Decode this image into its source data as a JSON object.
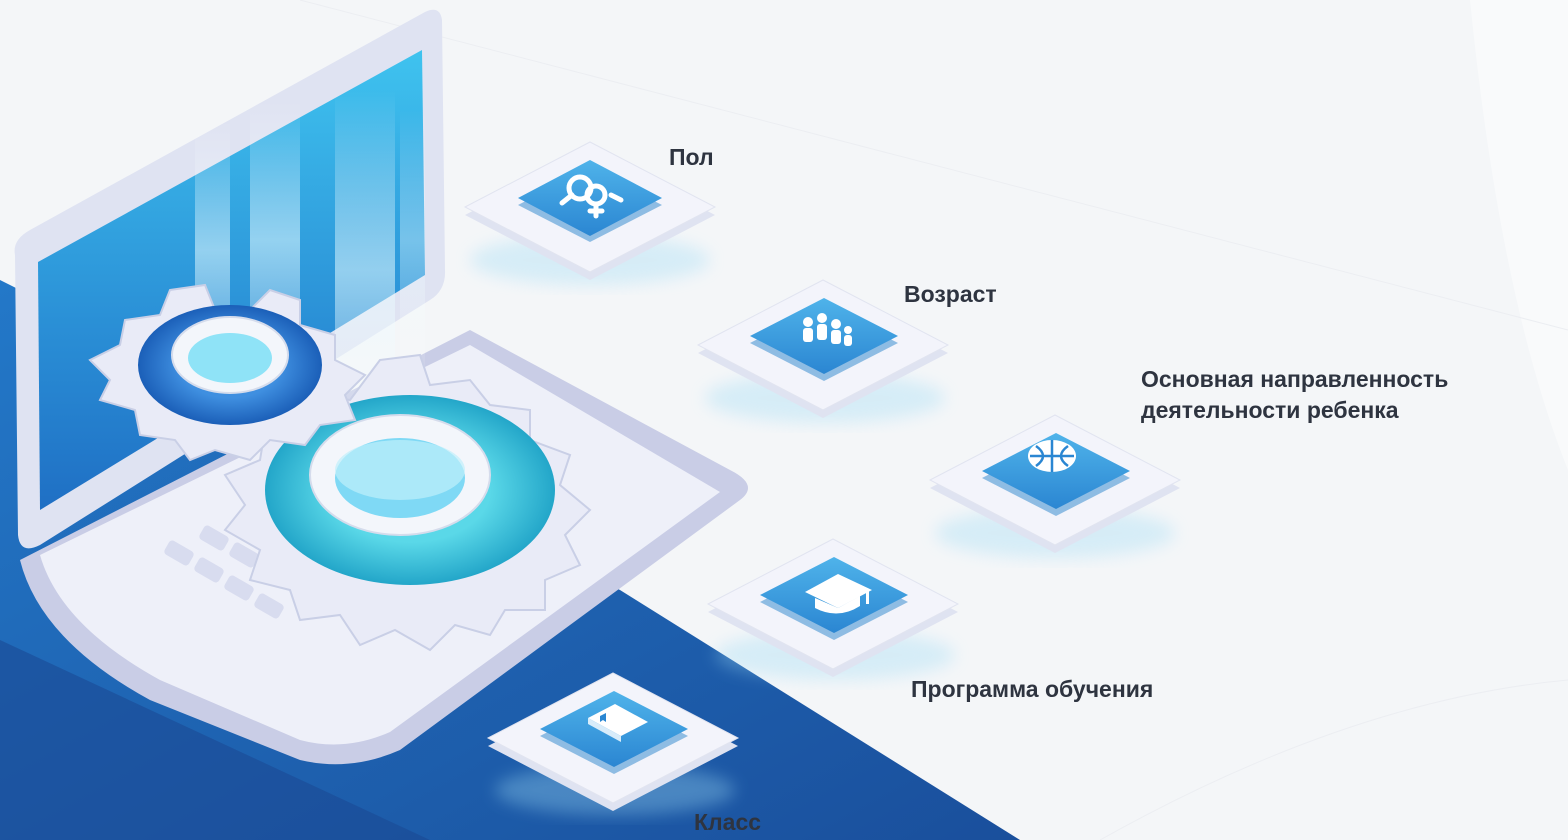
{
  "labels": {
    "gender": "Пол",
    "age": "Возраст",
    "activity_line1": "Основная направленность",
    "activity_line2": "деятельности ребенка",
    "program": "Программа обучения",
    "grade": "Класс"
  },
  "icons": {
    "gender": "gender-symbols-icon",
    "age": "people-group-icon",
    "activity": "basketball-icon",
    "program": "graduation-cap-icon",
    "grade": "book-icon",
    "gears": "gear-icon"
  },
  "colors": {
    "accent_blue": "#2f9fdf",
    "deep_blue": "#1b5fa8",
    "tile_top": "#e8ebf5",
    "label_text": "#2e3440"
  }
}
